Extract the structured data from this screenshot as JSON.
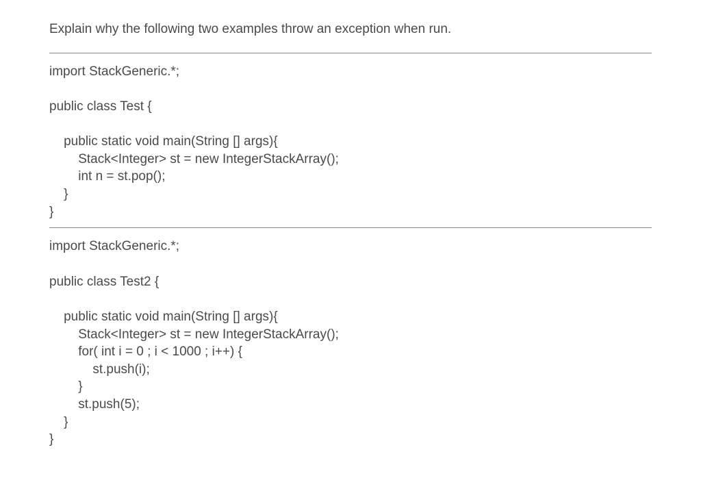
{
  "question": "Explain why the following two examples throw an exception when run.",
  "code1": "import StackGeneric.*;\n\npublic class Test {\n\n    public static void main(String [] args){\n        Stack<Integer> st = new IntegerStackArray();\n        int n = st.pop();\n    }\n}",
  "code2": "import StackGeneric.*;\n\npublic class Test2 {\n\n    public static void main(String [] args){\n        Stack<Integer> st = new IntegerStackArray();\n        for( int i = 0 ; i < 1000 ; i++) {\n            st.push(i);\n        }\n        st.push(5);\n    }\n}"
}
